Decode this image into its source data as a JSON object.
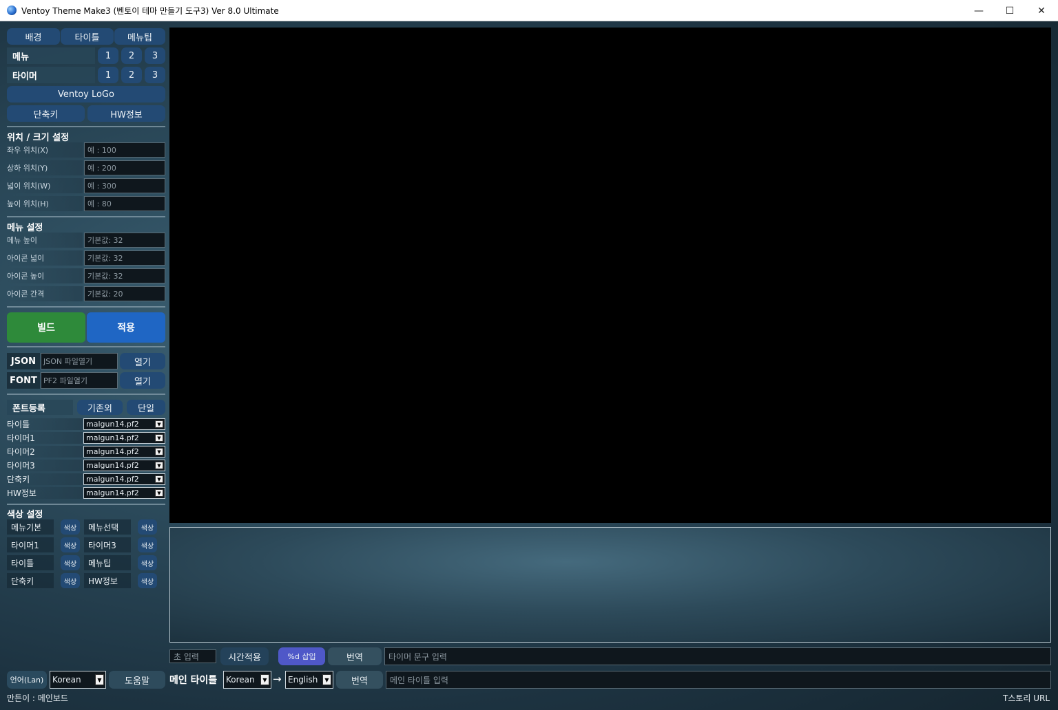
{
  "window": {
    "title": "Ventoy Theme Make3 (벤토이 테마 만들기 도구3)  Ver 8.0 Ultimate",
    "minimize": "—",
    "maximize": "☐",
    "close": "✕"
  },
  "top_tabs": [
    "배경",
    "타이틀",
    "메뉴팁"
  ],
  "menu_row": {
    "label": "메뉴",
    "buttons": [
      "1",
      "2",
      "3"
    ]
  },
  "timer_row": {
    "label": "타이머",
    "buttons": [
      "1",
      "2",
      "3"
    ]
  },
  "logo_button": "Ventoy LoGo",
  "shortcut_button": "단축키",
  "hwinfo_button": "HW정보",
  "position_section": {
    "title": "위치 / 크기 설정",
    "fields": [
      {
        "label": "좌우 위치(X)",
        "placeholder": "예 : 100"
      },
      {
        "label": "상하 위치(Y)",
        "placeholder": "예 : 200"
      },
      {
        "label": "넓이 위치(W)",
        "placeholder": "예 : 300"
      },
      {
        "label": "높이 위치(H)",
        "placeholder": "예 : 80"
      }
    ]
  },
  "menu_section": {
    "title": "메뉴 설정",
    "fields": [
      {
        "label": "메뉴 높이",
        "placeholder": "기본값: 32"
      },
      {
        "label": "아이콘 넓이",
        "placeholder": "기본값: 32"
      },
      {
        "label": "아이콘 높이",
        "placeholder": "기본값: 32"
      },
      {
        "label": "아이콘 간격",
        "placeholder": "기본값: 20"
      }
    ]
  },
  "build_button": "빌드",
  "apply_button": "적용",
  "json_row": {
    "label": "JSON",
    "placeholder": "JSON 파일열기",
    "button": "열기"
  },
  "font_row": {
    "label": "FONT",
    "placeholder": "PF2 파일열기",
    "button": "열기"
  },
  "font_register": {
    "label": "폰트등록",
    "btn_existing": "기존외",
    "btn_single": "단일",
    "rows": [
      {
        "label": "타이틀",
        "value": "malgun14.pf2"
      },
      {
        "label": "타이머1",
        "value": "malgun14.pf2"
      },
      {
        "label": "타이머2",
        "value": "malgun14.pf2"
      },
      {
        "label": "타이머3",
        "value": "malgun14.pf2"
      },
      {
        "label": "단축키",
        "value": "malgun14.pf2"
      },
      {
        "label": "HW정보",
        "value": "malgun14.pf2"
      }
    ]
  },
  "color_section": {
    "title": "색상 설정",
    "button_label": "색상",
    "left": [
      "메뉴기본",
      "타이머1",
      "타이틀",
      "단축키"
    ],
    "right": [
      "메뉴선택",
      "타이머3",
      "메뉴팁",
      "HW정보"
    ]
  },
  "language": {
    "label": "언어(Lan)",
    "value": "Korean",
    "help_button": "도움말"
  },
  "timer_bar": {
    "seconds_placeholder": "초 입력",
    "apply_time": "시간적용",
    "insert_d": "%d 삽입",
    "translate": "번역",
    "text_placeholder": "타이머 문구 입력"
  },
  "main_title_bar": {
    "label": "메인 타이틀",
    "from_lang": "Korean",
    "arrow": "→",
    "to_lang": "English",
    "translate": "번역",
    "placeholder": "메인 타이틀 입력"
  },
  "status": {
    "left": "만든이 : 메인보드",
    "right": "T스토리 URL"
  },
  "colors": {
    "button": "#234a74",
    "build": "#2e8a3a",
    "apply": "#1f66c4",
    "insert_d": "#4f58c8"
  }
}
